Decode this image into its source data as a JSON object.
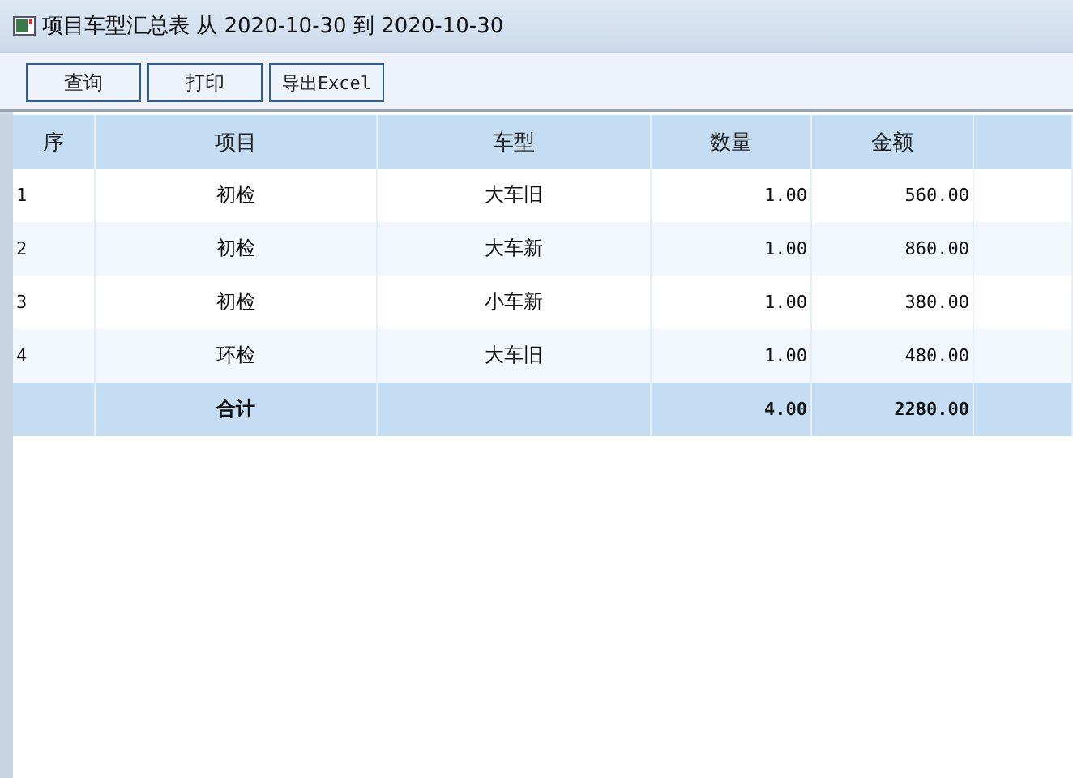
{
  "window": {
    "title": "项目车型汇总表 从 2020-10-30 到 2020-10-30"
  },
  "toolbar": {
    "buttons": [
      "查询",
      "打印",
      "导出Excel"
    ]
  },
  "table": {
    "columns": [
      "序",
      "项目",
      "车型",
      "数量",
      "金额"
    ],
    "rows": [
      {
        "cells": [
          "1",
          "初检",
          "大车旧",
          "1.00",
          "560.00"
        ]
      },
      {
        "cells": [
          "2",
          "初检",
          "大车新",
          "1.00",
          "860.00"
        ]
      },
      {
        "cells": [
          "3",
          "初检",
          "小车新",
          "1.00",
          "380.00"
        ]
      },
      {
        "cells": [
          "4",
          "环检",
          "大车旧",
          "1.00",
          "480.00"
        ]
      }
    ],
    "total": {
      "label": "合计",
      "quantity": "4.00",
      "amount": "2280.00"
    }
  }
}
